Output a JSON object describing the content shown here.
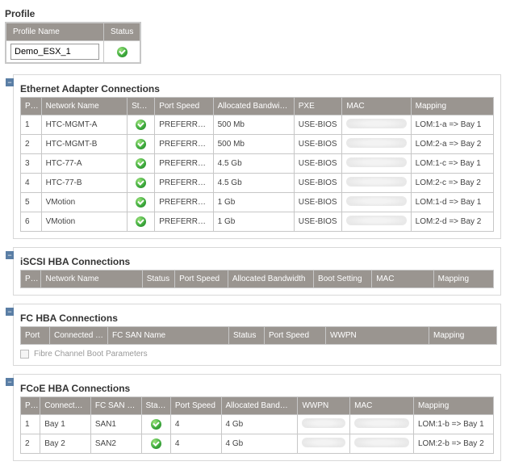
{
  "profile": {
    "title": "Profile",
    "cols": {
      "name": "Profile Name",
      "status": "Status"
    },
    "name_value": "Demo_ESX_1"
  },
  "ethernet": {
    "title": "Ethernet Adapter Connections",
    "cols": {
      "port": "Port",
      "name": "Network Name",
      "status": "Status",
      "speed": "Port Speed",
      "bw": "Allocated Bandwidth",
      "pxe": "PXE",
      "mac": "MAC",
      "map": "Mapping"
    },
    "rows": [
      {
        "port": "1",
        "name": "HTC-MGMT-A",
        "speed": "PREFERRED",
        "bw": "500 Mb",
        "pxe": "USE-BIOS",
        "map": "LOM:1-a => Bay 1"
      },
      {
        "port": "2",
        "name": "HTC-MGMT-B",
        "speed": "PREFERRED",
        "bw": "500 Mb",
        "pxe": "USE-BIOS",
        "map": "LOM:2-a => Bay 2"
      },
      {
        "port": "3",
        "name": "HTC-77-A",
        "speed": "PREFERRED",
        "bw": "4.5 Gb",
        "pxe": "USE-BIOS",
        "map": "LOM:1-c => Bay 1"
      },
      {
        "port": "4",
        "name": "HTC-77-B",
        "speed": "PREFERRED",
        "bw": "4.5 Gb",
        "pxe": "USE-BIOS",
        "map": "LOM:2-c => Bay 2"
      },
      {
        "port": "5",
        "name": "VMotion",
        "speed": "PREFERRED",
        "bw": "1 Gb",
        "pxe": "USE-BIOS",
        "map": "LOM:1-d => Bay 1"
      },
      {
        "port": "6",
        "name": "VMotion",
        "speed": "PREFERRED",
        "bw": "1 Gb",
        "pxe": "USE-BIOS",
        "map": "LOM:2-d => Bay 2"
      }
    ]
  },
  "iscsi": {
    "title": "iSCSI HBA Connections",
    "cols": {
      "port": "Port",
      "name": "Network Name",
      "status": "Status",
      "speed": "Port Speed",
      "bw": "Allocated Bandwidth",
      "boot": "Boot Setting",
      "mac": "MAC",
      "map": "Mapping"
    }
  },
  "fc": {
    "title": "FC HBA Connections",
    "cols": {
      "port": "Port",
      "connected": "Connected To",
      "san": "FC SAN Name",
      "status": "Status",
      "speed": "Port Speed",
      "wwpn": "WWPN",
      "map": "Mapping"
    },
    "footer": "Fibre Channel Boot Parameters"
  },
  "fcoe": {
    "title": "FCoE HBA Connections",
    "cols": {
      "port": "Port",
      "connected": "Connected To",
      "san": "FC SAN Name",
      "status": "Status",
      "speed": "Port Speed",
      "bw": "Allocated Bandwidth",
      "wwpn": "WWPN",
      "mac": "MAC",
      "map": "Mapping"
    },
    "rows": [
      {
        "port": "1",
        "connected": "Bay 1",
        "san": "SAN1",
        "speed": "4",
        "bw": "4 Gb",
        "map": "LOM:1-b => Bay 1"
      },
      {
        "port": "2",
        "connected": "Bay 2",
        "san": "SAN2",
        "speed": "4",
        "bw": "4 Gb",
        "map": "LOM:2-b => Bay 2"
      }
    ]
  }
}
